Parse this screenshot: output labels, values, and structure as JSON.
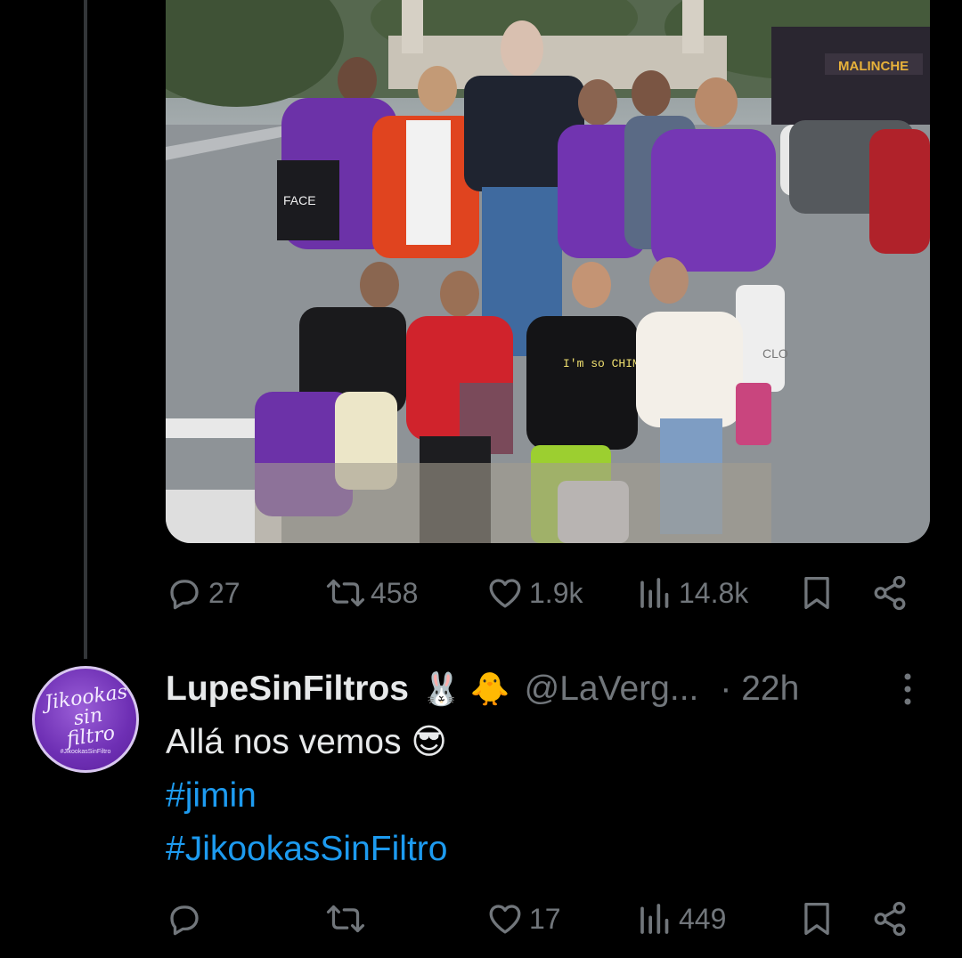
{
  "tweet1": {
    "image_alt": "Group photo of women with a cardboard cutout on a city avenue",
    "photo_text": {
      "bus_sign": "MALINCHE",
      "bag_text": "FACE",
      "shirt_text": "I'm so CHIMOLA",
      "shopping_bag": "CLO"
    },
    "actions": {
      "replies": "27",
      "reposts": "458",
      "likes": "1.9k",
      "views": "14.8k"
    }
  },
  "tweet2": {
    "avatar_label": "Jikookas sin filtro",
    "avatar_small_text": "#JikookasSinFiltro",
    "display_name": "LupeSinFiltros",
    "name_emojis": "🐰 🐥",
    "handle": "@LaVerg...",
    "time": "· 22h",
    "text": "Allá nos vemos 😎",
    "hashtags": [
      "#jimin",
      "#JikookasSinFiltro"
    ],
    "actions": {
      "replies": "",
      "reposts": "",
      "likes": "17",
      "views": "449"
    }
  },
  "colors": {
    "background": "#000000",
    "text": "#e7e9ea",
    "muted": "#71767b",
    "link": "#1d9bf0",
    "thread_line": "#333639"
  }
}
